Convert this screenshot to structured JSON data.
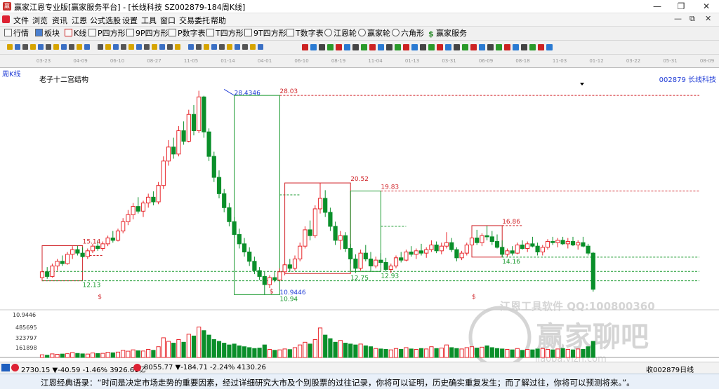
{
  "window": {
    "title": "赢家江恩专业版[赢家服务平台] - [长线科技  SZ002879-184周K线]",
    "controls": [
      "—",
      "❐",
      "✕"
    ]
  },
  "menu": {
    "items": [
      "文件",
      "浏览",
      "资讯",
      "江恩",
      "公式选股",
      "设置",
      "工具",
      "窗口",
      "交易委托",
      "帮助"
    ],
    "mdi_controls": [
      "—",
      "⧉",
      "✕"
    ]
  },
  "toolbar": {
    "items": [
      {
        "label": "行情",
        "icon": "grid-icon"
      },
      {
        "label": "板块",
        "icon": "blocks-icon"
      },
      {
        "label": "K线",
        "icon": "candle-icon"
      },
      {
        "label": "P四方形",
        "icon": "square-p-icon"
      },
      {
        "label": "9P四方形",
        "icon": "square-9p-icon"
      },
      {
        "label": "P数字表",
        "icon": "table-p-icon"
      },
      {
        "label": "T四方形",
        "icon": "square-t-icon"
      },
      {
        "label": "9T四方形",
        "icon": "square-9t-icon"
      },
      {
        "label": "T数字表",
        "icon": "table-t-icon"
      },
      {
        "label": "江恩轮",
        "icon": "wheel-icon"
      },
      {
        "label": "赢家轮",
        "icon": "wheel2-icon"
      },
      {
        "label": "六角形",
        "icon": "hexagon-icon"
      },
      {
        "label": "赢家服务",
        "icon": "dollar-icon"
      }
    ]
  },
  "chart_header": {
    "period_label": "周K线",
    "formula_name": "老子十二宫结构",
    "stock_label": "002879  长线科技",
    "top_dates": [
      "03-23",
      "04-09",
      "06-10",
      "08-27",
      "11-05",
      "01-14",
      "04-01",
      "06-10",
      "08-19",
      "11-04",
      "01-13",
      "03-31",
      "06-09",
      "08-18",
      "11-03",
      "01-12",
      "03-22",
      "05-31",
      "08-09"
    ]
  },
  "chart_data": {
    "type": "candlestick",
    "title": "老子十二宫结构",
    "symbol": "002879",
    "name": "长线科技",
    "period": "周K线",
    "y_scale_note": "price in CNY",
    "ylim": [
      10.0,
      29.0
    ],
    "annotations": {
      "high_all": "28.4346",
      "box_top": "28.03",
      "box_bottom": "10.94",
      "low_all": "10.9446",
      "left_box_top": "15.14",
      "left_box_bottom": "12.13",
      "mid_high": "20.52",
      "mid_box_top": "19.83",
      "mid_box_low1": "12.75",
      "mid_box_low2": "12.93",
      "right_high": "16.86",
      "right_low": "14.16",
      "axis_low": "10.9446",
      "dollar": "$"
    },
    "volume_axis": [
      "485695",
      "323797",
      "161898"
    ],
    "watermark": {
      "line1": "江恩工具软件  QQ:100800360",
      "line2": "赢家聊吧",
      "line3": "liaoba.yjzh.com"
    },
    "candles": [
      {
        "o": 12.4,
        "h": 13.2,
        "l": 12.1,
        "c": 12.9
      },
      {
        "o": 12.9,
        "h": 13.3,
        "l": 12.3,
        "c": 12.5
      },
      {
        "o": 12.5,
        "h": 13.6,
        "l": 12.4,
        "c": 13.4
      },
      {
        "o": 13.4,
        "h": 14.0,
        "l": 13.0,
        "c": 13.8
      },
      {
        "o": 13.8,
        "h": 14.3,
        "l": 13.4,
        "c": 13.6
      },
      {
        "o": 13.6,
        "h": 14.6,
        "l": 13.5,
        "c": 14.4
      },
      {
        "o": 14.4,
        "h": 15.1,
        "l": 14.0,
        "c": 14.8
      },
      {
        "o": 14.8,
        "h": 15.14,
        "l": 14.3,
        "c": 14.5
      },
      {
        "o": 14.5,
        "h": 15.0,
        "l": 14.1,
        "c": 14.2
      },
      {
        "o": 14.2,
        "h": 14.9,
        "l": 14.0,
        "c": 14.7
      },
      {
        "o": 14.7,
        "h": 15.3,
        "l": 14.5,
        "c": 15.1
      },
      {
        "o": 15.1,
        "h": 15.6,
        "l": 14.7,
        "c": 14.9
      },
      {
        "o": 14.9,
        "h": 15.5,
        "l": 14.7,
        "c": 15.3
      },
      {
        "o": 15.3,
        "h": 16.0,
        "l": 15.1,
        "c": 15.8
      },
      {
        "o": 15.8,
        "h": 16.4,
        "l": 15.4,
        "c": 15.6
      },
      {
        "o": 15.6,
        "h": 16.6,
        "l": 15.5,
        "c": 16.4
      },
      {
        "o": 16.4,
        "h": 17.5,
        "l": 16.2,
        "c": 17.2
      },
      {
        "o": 17.2,
        "h": 18.2,
        "l": 16.9,
        "c": 17.8
      },
      {
        "o": 17.8,
        "h": 18.8,
        "l": 17.4,
        "c": 18.5
      },
      {
        "o": 18.5,
        "h": 19.3,
        "l": 17.9,
        "c": 18.1
      },
      {
        "o": 18.1,
        "h": 19.0,
        "l": 17.6,
        "c": 18.8
      },
      {
        "o": 18.8,
        "h": 19.6,
        "l": 18.4,
        "c": 19.3
      },
      {
        "o": 19.3,
        "h": 19.8,
        "l": 18.6,
        "c": 18.9
      },
      {
        "o": 18.9,
        "h": 20.6,
        "l": 18.7,
        "c": 20.3
      },
      {
        "o": 20.3,
        "h": 22.8,
        "l": 20.0,
        "c": 22.4
      },
      {
        "o": 22.4,
        "h": 24.2,
        "l": 22.0,
        "c": 23.6
      },
      {
        "o": 23.6,
        "h": 24.4,
        "l": 22.6,
        "c": 23.0
      },
      {
        "o": 23.0,
        "h": 25.4,
        "l": 22.8,
        "c": 25.0
      },
      {
        "o": 25.0,
        "h": 25.8,
        "l": 23.8,
        "c": 24.1
      },
      {
        "o": 24.1,
        "h": 26.8,
        "l": 24.0,
        "c": 26.4
      },
      {
        "o": 26.4,
        "h": 27.2,
        "l": 24.6,
        "c": 25.0
      },
      {
        "o": 25.0,
        "h": 28.43,
        "l": 24.8,
        "c": 27.9
      },
      {
        "o": 27.9,
        "h": 28.0,
        "l": 24.4,
        "c": 24.9
      },
      {
        "o": 24.9,
        "h": 25.2,
        "l": 22.4,
        "c": 22.8
      },
      {
        "o": 22.8,
        "h": 23.2,
        "l": 20.6,
        "c": 21.0
      },
      {
        "o": 21.0,
        "h": 21.6,
        "l": 19.2,
        "c": 19.6
      },
      {
        "o": 19.6,
        "h": 20.0,
        "l": 18.0,
        "c": 18.4
      },
      {
        "o": 18.4,
        "h": 18.8,
        "l": 16.8,
        "c": 17.2
      },
      {
        "o": 17.2,
        "h": 17.6,
        "l": 15.8,
        "c": 16.1
      },
      {
        "o": 16.1,
        "h": 16.6,
        "l": 14.9,
        "c": 15.3
      },
      {
        "o": 15.3,
        "h": 15.8,
        "l": 14.2,
        "c": 14.6
      },
      {
        "o": 14.6,
        "h": 15.0,
        "l": 13.4,
        "c": 13.8
      },
      {
        "o": 13.8,
        "h": 14.2,
        "l": 12.7,
        "c": 13.0
      },
      {
        "o": 13.0,
        "h": 13.3,
        "l": 12.2,
        "c": 12.5
      },
      {
        "o": 12.5,
        "h": 12.9,
        "l": 10.94,
        "c": 11.8
      },
      {
        "o": 11.8,
        "h": 12.6,
        "l": 11.5,
        "c": 12.4
      },
      {
        "o": 12.4,
        "h": 12.9,
        "l": 12.0,
        "c": 12.2
      },
      {
        "o": 12.2,
        "h": 13.2,
        "l": 12.1,
        "c": 12.9
      },
      {
        "o": 12.9,
        "h": 13.7,
        "l": 12.6,
        "c": 13.5
      },
      {
        "o": 13.5,
        "h": 14.0,
        "l": 12.9,
        "c": 13.2
      },
      {
        "o": 13.2,
        "h": 14.3,
        "l": 13.0,
        "c": 14.0
      },
      {
        "o": 14.0,
        "h": 15.4,
        "l": 13.8,
        "c": 15.1
      },
      {
        "o": 15.1,
        "h": 16.8,
        "l": 14.9,
        "c": 16.5
      },
      {
        "o": 16.5,
        "h": 17.3,
        "l": 15.6,
        "c": 16.0
      },
      {
        "o": 16.0,
        "h": 18.6,
        "l": 15.8,
        "c": 18.3
      },
      {
        "o": 18.3,
        "h": 20.52,
        "l": 17.9,
        "c": 19.2
      },
      {
        "o": 19.2,
        "h": 19.9,
        "l": 17.6,
        "c": 18.0
      },
      {
        "o": 18.0,
        "h": 18.4,
        "l": 16.4,
        "c": 16.8
      },
      {
        "o": 16.8,
        "h": 17.2,
        "l": 15.2,
        "c": 15.6
      },
      {
        "o": 15.6,
        "h": 16.4,
        "l": 14.8,
        "c": 16.0
      },
      {
        "o": 16.0,
        "h": 16.3,
        "l": 14.6,
        "c": 14.9
      },
      {
        "o": 14.9,
        "h": 15.3,
        "l": 13.6,
        "c": 14.0
      },
      {
        "o": 14.0,
        "h": 14.4,
        "l": 12.8,
        "c": 13.2
      },
      {
        "o": 13.2,
        "h": 14.8,
        "l": 13.0,
        "c": 14.5
      },
      {
        "o": 14.5,
        "h": 15.2,
        "l": 13.8,
        "c": 14.0
      },
      {
        "o": 14.0,
        "h": 14.6,
        "l": 12.93,
        "c": 13.4
      },
      {
        "o": 13.4,
        "h": 14.2,
        "l": 13.2,
        "c": 13.9
      },
      {
        "o": 13.9,
        "h": 14.5,
        "l": 13.5,
        "c": 13.7
      },
      {
        "o": 13.7,
        "h": 14.1,
        "l": 12.9,
        "c": 13.1
      },
      {
        "o": 13.1,
        "h": 13.6,
        "l": 12.8,
        "c": 13.4
      },
      {
        "o": 13.4,
        "h": 14.3,
        "l": 13.2,
        "c": 14.1
      },
      {
        "o": 14.1,
        "h": 14.6,
        "l": 13.7,
        "c": 13.9
      },
      {
        "o": 13.9,
        "h": 14.8,
        "l": 13.8,
        "c": 14.6
      },
      {
        "o": 14.6,
        "h": 15.1,
        "l": 14.2,
        "c": 14.4
      },
      {
        "o": 14.4,
        "h": 14.9,
        "l": 14.0,
        "c": 14.7
      },
      {
        "o": 14.7,
        "h": 15.3,
        "l": 14.3,
        "c": 14.5
      },
      {
        "o": 14.5,
        "h": 15.0,
        "l": 14.1,
        "c": 14.8
      },
      {
        "o": 14.8,
        "h": 15.6,
        "l": 14.6,
        "c": 15.2
      },
      {
        "o": 15.2,
        "h": 15.5,
        "l": 14.5,
        "c": 14.7
      },
      {
        "o": 14.7,
        "h": 15.4,
        "l": 14.4,
        "c": 15.1
      },
      {
        "o": 15.1,
        "h": 16.3,
        "l": 14.9,
        "c": 15.4
      },
      {
        "o": 15.4,
        "h": 15.8,
        "l": 14.6,
        "c": 14.8
      },
      {
        "o": 14.8,
        "h": 15.0,
        "l": 13.8,
        "c": 14.1
      },
      {
        "o": 14.1,
        "h": 14.7,
        "l": 13.9,
        "c": 14.5
      },
      {
        "o": 14.5,
        "h": 15.4,
        "l": 14.3,
        "c": 15.2
      },
      {
        "o": 15.2,
        "h": 16.1,
        "l": 15.0,
        "c": 15.8
      },
      {
        "o": 15.8,
        "h": 16.5,
        "l": 15.2,
        "c": 15.4
      },
      {
        "o": 15.4,
        "h": 16.2,
        "l": 15.1,
        "c": 16.0
      },
      {
        "o": 16.0,
        "h": 16.86,
        "l": 15.6,
        "c": 15.9
      },
      {
        "o": 15.9,
        "h": 16.4,
        "l": 15.2,
        "c": 15.5
      },
      {
        "o": 15.5,
        "h": 16.1,
        "l": 14.9,
        "c": 15.0
      },
      {
        "o": 15.0,
        "h": 15.6,
        "l": 14.16,
        "c": 14.4
      },
      {
        "o": 14.4,
        "h": 14.9,
        "l": 14.2,
        "c": 14.7
      },
      {
        "o": 14.7,
        "h": 15.1,
        "l": 14.3,
        "c": 14.5
      },
      {
        "o": 14.5,
        "h": 15.4,
        "l": 14.4,
        "c": 15.2
      },
      {
        "o": 15.2,
        "h": 15.6,
        "l": 14.8,
        "c": 14.9
      },
      {
        "o": 14.9,
        "h": 15.5,
        "l": 14.6,
        "c": 15.3
      },
      {
        "o": 15.3,
        "h": 15.9,
        "l": 15.0,
        "c": 15.1
      },
      {
        "o": 15.1,
        "h": 15.4,
        "l": 14.3,
        "c": 14.6
      },
      {
        "o": 14.6,
        "h": 15.2,
        "l": 14.3,
        "c": 15.0
      },
      {
        "o": 15.0,
        "h": 15.7,
        "l": 14.8,
        "c": 15.5
      },
      {
        "o": 15.5,
        "h": 15.9,
        "l": 15.2,
        "c": 15.4
      },
      {
        "o": 15.4,
        "h": 15.8,
        "l": 15.0,
        "c": 15.6
      },
      {
        "o": 15.6,
        "h": 15.9,
        "l": 15.2,
        "c": 15.3
      },
      {
        "o": 15.3,
        "h": 15.8,
        "l": 14.9,
        "c": 15.5
      },
      {
        "o": 15.5,
        "h": 15.9,
        "l": 15.1,
        "c": 15.2
      },
      {
        "o": 15.2,
        "h": 15.6,
        "l": 14.8,
        "c": 15.4
      },
      {
        "o": 15.4,
        "h": 15.9,
        "l": 15.0,
        "c": 15.1
      },
      {
        "o": 15.1,
        "h": 15.3,
        "l": 14.3,
        "c": 14.5
      },
      {
        "o": 14.5,
        "h": 14.6,
        "l": 11.2,
        "c": 11.4
      }
    ],
    "volumes": [
      30,
      25,
      40,
      35,
      38,
      42,
      55,
      45,
      40,
      38,
      50,
      44,
      46,
      58,
      52,
      60,
      80,
      70,
      85,
      75,
      72,
      90,
      80,
      120,
      220,
      180,
      160,
      200,
      170,
      260,
      240,
      340,
      300,
      250,
      200,
      180,
      160,
      140,
      150,
      130,
      120,
      110,
      100,
      105,
      140,
      90,
      80,
      85,
      95,
      88,
      110,
      140,
      170,
      150,
      200,
      330,
      250,
      210,
      170,
      190,
      160,
      150,
      140,
      150,
      130,
      120,
      100,
      95,
      90,
      85,
      100,
      90,
      110,
      95,
      90,
      100,
      95,
      120,
      100,
      105,
      140,
      110,
      100,
      95,
      110,
      120,
      105,
      115,
      130,
      110,
      100,
      95,
      90,
      85,
      100,
      80,
      90,
      85,
      95,
      100,
      90,
      85,
      95,
      100,
      90,
      85,
      95,
      90,
      120,
      180
    ],
    "vol_ylim": [
      0,
      486000
    ]
  },
  "status": {
    "index1": "2730.15 ▼-40.59 -1.46% 3926.61亿",
    "index2": "8055.77 ▼-184.71 -2.24% 4130.26",
    "right": "收002879日线"
  },
  "quote": {
    "text": "江恩经典语录：“时间是决定市场走势的重要因素，经过详细研究大市及个别股票的过往记录，你将可以证明，历史确实重复发生；而了解过往，你将可以预测将来。”。"
  },
  "colors": {
    "up": "#e8262b",
    "down": "#0a8f2a",
    "box_red": "#d1262b",
    "box_green": "#1a9a2f",
    "blue_label": "#1f3bd6"
  }
}
